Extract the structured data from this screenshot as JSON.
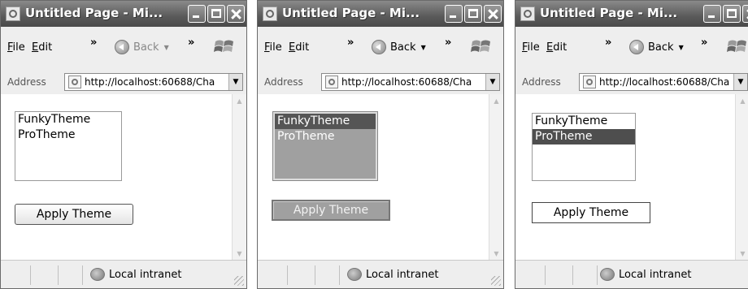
{
  "windows": [
    {
      "title": "Untitled Page - Mi...",
      "menus": [
        "File",
        "Edit"
      ],
      "back_label": "Back",
      "address_label": "Address",
      "address_value": "http://localhost:60688/Cha",
      "options": [
        "FunkyTheme",
        "ProTheme"
      ],
      "selected_option": null,
      "button_label": "Apply Theme",
      "status_zone": "Local intranet",
      "theme": "default"
    },
    {
      "title": "Untitled Page - Mi...",
      "menus": [
        "File",
        "Edit"
      ],
      "back_label": "Back",
      "address_label": "Address",
      "address_value": "http://localhost:60688/Cha",
      "options": [
        "FunkyTheme",
        "ProTheme"
      ],
      "selected_option": "FunkyTheme",
      "button_label": "Apply Theme",
      "status_zone": "Local intranet",
      "theme": "funky"
    },
    {
      "title": "Untitled Page - Mi...",
      "menus": [
        "File",
        "Edit"
      ],
      "back_label": "Back",
      "address_label": "Address",
      "address_value": "http://localhost:60688/Cha",
      "options": [
        "FunkyTheme",
        "ProTheme"
      ],
      "selected_option": "ProTheme",
      "button_label": "Apply Theme",
      "status_zone": "Local intranet",
      "theme": "pro"
    }
  ],
  "colors": {
    "titlebar": "#5a5a5a",
    "chrome": "#eeeeee",
    "funky_list_bg": "#a0a0a0",
    "selection": "#555555"
  }
}
